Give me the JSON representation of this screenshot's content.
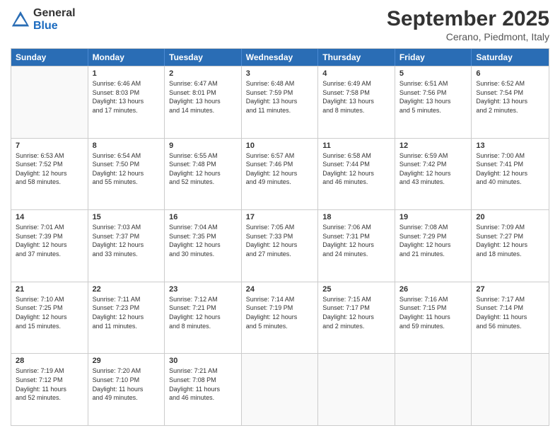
{
  "logo": {
    "general": "General",
    "blue": "Blue"
  },
  "header": {
    "month": "September 2025",
    "location": "Cerano, Piedmont, Italy"
  },
  "days": [
    "Sunday",
    "Monday",
    "Tuesday",
    "Wednesday",
    "Thursday",
    "Friday",
    "Saturday"
  ],
  "weeks": [
    [
      {
        "day": "",
        "info": ""
      },
      {
        "day": "1",
        "info": "Sunrise: 6:46 AM\nSunset: 8:03 PM\nDaylight: 13 hours\nand 17 minutes."
      },
      {
        "day": "2",
        "info": "Sunrise: 6:47 AM\nSunset: 8:01 PM\nDaylight: 13 hours\nand 14 minutes."
      },
      {
        "day": "3",
        "info": "Sunrise: 6:48 AM\nSunset: 7:59 PM\nDaylight: 13 hours\nand 11 minutes."
      },
      {
        "day": "4",
        "info": "Sunrise: 6:49 AM\nSunset: 7:58 PM\nDaylight: 13 hours\nand 8 minutes."
      },
      {
        "day": "5",
        "info": "Sunrise: 6:51 AM\nSunset: 7:56 PM\nDaylight: 13 hours\nand 5 minutes."
      },
      {
        "day": "6",
        "info": "Sunrise: 6:52 AM\nSunset: 7:54 PM\nDaylight: 13 hours\nand 2 minutes."
      }
    ],
    [
      {
        "day": "7",
        "info": "Sunrise: 6:53 AM\nSunset: 7:52 PM\nDaylight: 12 hours\nand 58 minutes."
      },
      {
        "day": "8",
        "info": "Sunrise: 6:54 AM\nSunset: 7:50 PM\nDaylight: 12 hours\nand 55 minutes."
      },
      {
        "day": "9",
        "info": "Sunrise: 6:55 AM\nSunset: 7:48 PM\nDaylight: 12 hours\nand 52 minutes."
      },
      {
        "day": "10",
        "info": "Sunrise: 6:57 AM\nSunset: 7:46 PM\nDaylight: 12 hours\nand 49 minutes."
      },
      {
        "day": "11",
        "info": "Sunrise: 6:58 AM\nSunset: 7:44 PM\nDaylight: 12 hours\nand 46 minutes."
      },
      {
        "day": "12",
        "info": "Sunrise: 6:59 AM\nSunset: 7:42 PM\nDaylight: 12 hours\nand 43 minutes."
      },
      {
        "day": "13",
        "info": "Sunrise: 7:00 AM\nSunset: 7:41 PM\nDaylight: 12 hours\nand 40 minutes."
      }
    ],
    [
      {
        "day": "14",
        "info": "Sunrise: 7:01 AM\nSunset: 7:39 PM\nDaylight: 12 hours\nand 37 minutes."
      },
      {
        "day": "15",
        "info": "Sunrise: 7:03 AM\nSunset: 7:37 PM\nDaylight: 12 hours\nand 33 minutes."
      },
      {
        "day": "16",
        "info": "Sunrise: 7:04 AM\nSunset: 7:35 PM\nDaylight: 12 hours\nand 30 minutes."
      },
      {
        "day": "17",
        "info": "Sunrise: 7:05 AM\nSunset: 7:33 PM\nDaylight: 12 hours\nand 27 minutes."
      },
      {
        "day": "18",
        "info": "Sunrise: 7:06 AM\nSunset: 7:31 PM\nDaylight: 12 hours\nand 24 minutes."
      },
      {
        "day": "19",
        "info": "Sunrise: 7:08 AM\nSunset: 7:29 PM\nDaylight: 12 hours\nand 21 minutes."
      },
      {
        "day": "20",
        "info": "Sunrise: 7:09 AM\nSunset: 7:27 PM\nDaylight: 12 hours\nand 18 minutes."
      }
    ],
    [
      {
        "day": "21",
        "info": "Sunrise: 7:10 AM\nSunset: 7:25 PM\nDaylight: 12 hours\nand 15 minutes."
      },
      {
        "day": "22",
        "info": "Sunrise: 7:11 AM\nSunset: 7:23 PM\nDaylight: 12 hours\nand 11 minutes."
      },
      {
        "day": "23",
        "info": "Sunrise: 7:12 AM\nSunset: 7:21 PM\nDaylight: 12 hours\nand 8 minutes."
      },
      {
        "day": "24",
        "info": "Sunrise: 7:14 AM\nSunset: 7:19 PM\nDaylight: 12 hours\nand 5 minutes."
      },
      {
        "day": "25",
        "info": "Sunrise: 7:15 AM\nSunset: 7:17 PM\nDaylight: 12 hours\nand 2 minutes."
      },
      {
        "day": "26",
        "info": "Sunrise: 7:16 AM\nSunset: 7:15 PM\nDaylight: 11 hours\nand 59 minutes."
      },
      {
        "day": "27",
        "info": "Sunrise: 7:17 AM\nSunset: 7:14 PM\nDaylight: 11 hours\nand 56 minutes."
      }
    ],
    [
      {
        "day": "28",
        "info": "Sunrise: 7:19 AM\nSunset: 7:12 PM\nDaylight: 11 hours\nand 52 minutes."
      },
      {
        "day": "29",
        "info": "Sunrise: 7:20 AM\nSunset: 7:10 PM\nDaylight: 11 hours\nand 49 minutes."
      },
      {
        "day": "30",
        "info": "Sunrise: 7:21 AM\nSunset: 7:08 PM\nDaylight: 11 hours\nand 46 minutes."
      },
      {
        "day": "",
        "info": ""
      },
      {
        "day": "",
        "info": ""
      },
      {
        "day": "",
        "info": ""
      },
      {
        "day": "",
        "info": ""
      }
    ]
  ]
}
